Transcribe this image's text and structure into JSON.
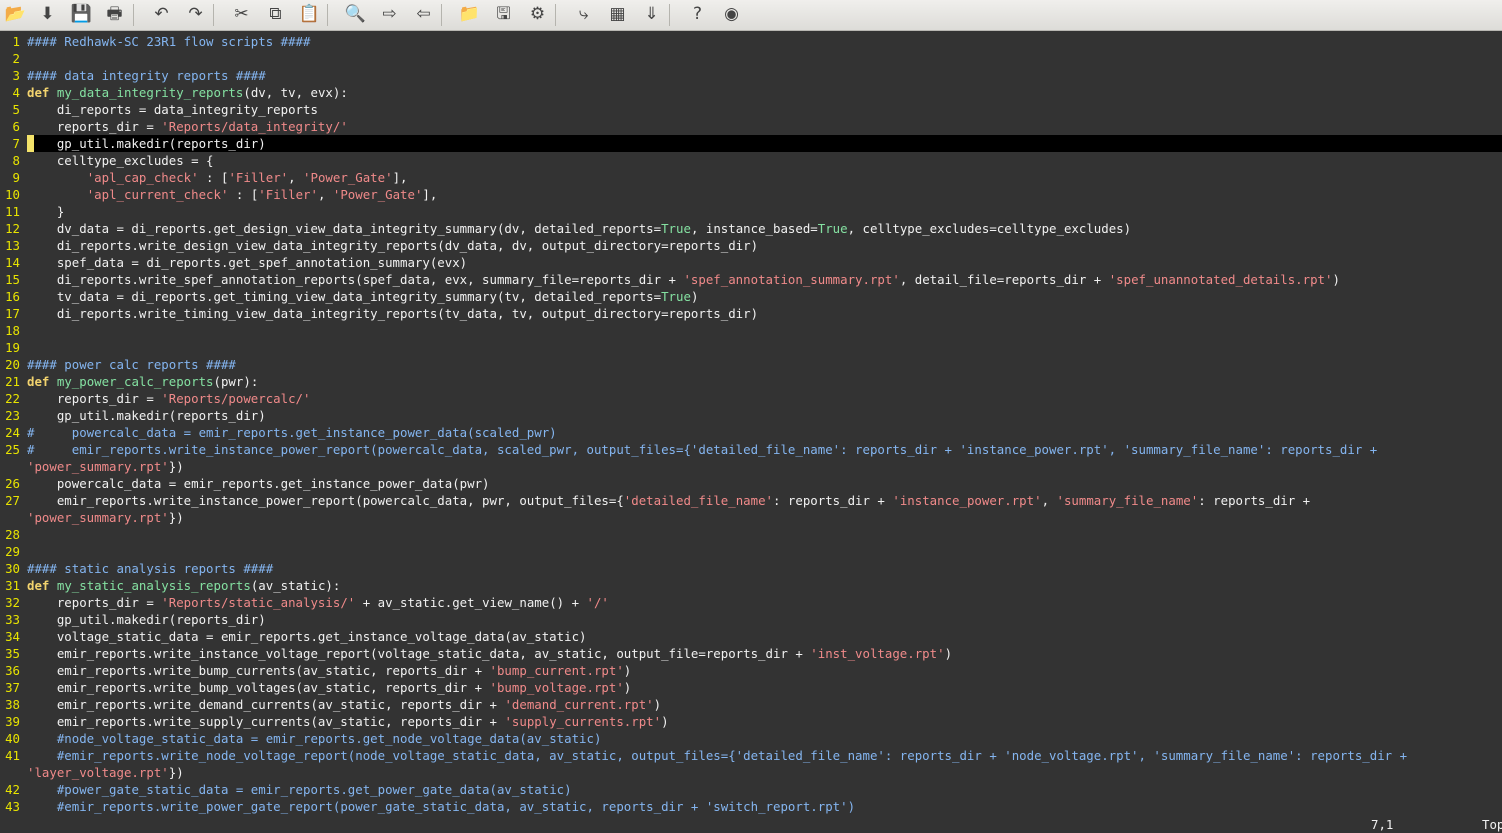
{
  "toolbar": {
    "buttons": [
      {
        "name": "open-icon",
        "glyph": "📂"
      },
      {
        "name": "load-icon",
        "glyph": "⬇"
      },
      {
        "name": "save-icon",
        "glyph": "💾"
      },
      {
        "name": "print-icon",
        "glyph": "🖶"
      },
      {
        "name": "undo-icon",
        "glyph": "↶"
      },
      {
        "name": "redo-icon",
        "glyph": "↷"
      },
      {
        "name": "cut-icon",
        "glyph": "✂"
      },
      {
        "name": "copy-icon",
        "glyph": "⧉"
      },
      {
        "name": "paste-icon",
        "glyph": "📋"
      },
      {
        "name": "find-replace-icon",
        "glyph": "🔍"
      },
      {
        "name": "find-next-icon",
        "glyph": "⇨"
      },
      {
        "name": "find-prev-icon",
        "glyph": "⇦"
      },
      {
        "name": "session-load-icon",
        "glyph": "📁"
      },
      {
        "name": "session-save-icon",
        "glyph": "🖫"
      },
      {
        "name": "run-script-icon",
        "glyph": "⚙"
      },
      {
        "name": "tag-jump-icon",
        "glyph": "⤷"
      },
      {
        "name": "build-icon",
        "glyph": "▦"
      },
      {
        "name": "make-icon",
        "glyph": "⇓"
      },
      {
        "name": "help-icon",
        "glyph": "?"
      },
      {
        "name": "find-help-icon",
        "glyph": "◉"
      }
    ]
  },
  "editor": {
    "cursor_line": 7,
    "lines": [
      {
        "n": "1",
        "t": "#### Redhawk-SC 23R1 flow scripts ####"
      },
      {
        "n": "2",
        "t": ""
      },
      {
        "n": "3",
        "t": "#### data integrity reports ####"
      },
      {
        "n": "4",
        "t": "def my_data_integrity_reports(dv, tv, evx):"
      },
      {
        "n": "5",
        "t": "    di_reports = data_integrity_reports"
      },
      {
        "n": "6",
        "t": "    reports_dir = 'Reports/data_integrity/'"
      },
      {
        "n": "7",
        "t": "    gp_util.makedir(reports_dir)"
      },
      {
        "n": "8",
        "t": "    celltype_excludes = {"
      },
      {
        "n": "9",
        "t": "        'apl_cap_check' : ['Filler', 'Power_Gate'],"
      },
      {
        "n": "10",
        "t": "        'apl_current_check' : ['Filler', 'Power_Gate'],"
      },
      {
        "n": "11",
        "t": "    }"
      },
      {
        "n": "12",
        "t": "    dv_data = di_reports.get_design_view_data_integrity_summary(dv, detailed_reports=True, instance_based=True, celltype_excludes=celltype_excludes)"
      },
      {
        "n": "13",
        "t": "    di_reports.write_design_view_data_integrity_reports(dv_data, dv, output_directory=reports_dir)"
      },
      {
        "n": "14",
        "t": "    spef_data = di_reports.get_spef_annotation_summary(evx)"
      },
      {
        "n": "15",
        "t": "    di_reports.write_spef_annotation_reports(spef_data, evx, summary_file=reports_dir + 'spef_annotation_summary.rpt', detail_file=reports_dir + 'spef_unannotated_details.rpt')"
      },
      {
        "n": "16",
        "t": "    tv_data = di_reports.get_timing_view_data_integrity_summary(tv, detailed_reports=True)"
      },
      {
        "n": "17",
        "t": "    di_reports.write_timing_view_data_integrity_reports(tv_data, tv, output_directory=reports_dir)"
      },
      {
        "n": "18",
        "t": ""
      },
      {
        "n": "19",
        "t": ""
      },
      {
        "n": "20",
        "t": "#### power calc reports ####"
      },
      {
        "n": "21",
        "t": "def my_power_calc_reports(pwr):"
      },
      {
        "n": "22",
        "t": "    reports_dir = 'Reports/powercalc/'"
      },
      {
        "n": "23",
        "t": "    gp_util.makedir(reports_dir)"
      },
      {
        "n": "24",
        "t": "#     powercalc_data = emir_reports.get_instance_power_data(scaled_pwr)"
      },
      {
        "n": "25",
        "t": "#     emir_reports.write_instance_power_report(powercalc_data, scaled_pwr, output_files={'detailed_file_name': reports_dir + 'instance_power.rpt', 'summary_file_name': reports_dir +"
      },
      {
        "n": "",
        "t": "'power_summary.rpt'})"
      },
      {
        "n": "26",
        "t": "    powercalc_data = emir_reports.get_instance_power_data(pwr)"
      },
      {
        "n": "27",
        "t": "    emir_reports.write_instance_power_report(powercalc_data, pwr, output_files={'detailed_file_name': reports_dir + 'instance_power.rpt', 'summary_file_name': reports_dir +"
      },
      {
        "n": "",
        "t": "'power_summary.rpt'})"
      },
      {
        "n": "28",
        "t": ""
      },
      {
        "n": "29",
        "t": ""
      },
      {
        "n": "30",
        "t": "#### static analysis reports ####"
      },
      {
        "n": "31",
        "t": "def my_static_analysis_reports(av_static):"
      },
      {
        "n": "32",
        "t": "    reports_dir = 'Reports/static_analysis/' + av_static.get_view_name() + '/'"
      },
      {
        "n": "33",
        "t": "    gp_util.makedir(reports_dir)"
      },
      {
        "n": "34",
        "t": "    voltage_static_data = emir_reports.get_instance_voltage_data(av_static)"
      },
      {
        "n": "35",
        "t": "    emir_reports.write_instance_voltage_report(voltage_static_data, av_static, output_file=reports_dir + 'inst_voltage.rpt')"
      },
      {
        "n": "36",
        "t": "    emir_reports.write_bump_currents(av_static, reports_dir + 'bump_current.rpt')"
      },
      {
        "n": "37",
        "t": "    emir_reports.write_bump_voltages(av_static, reports_dir + 'bump_voltage.rpt')"
      },
      {
        "n": "38",
        "t": "    emir_reports.write_demand_currents(av_static, reports_dir + 'demand_current.rpt')"
      },
      {
        "n": "39",
        "t": "    emir_reports.write_supply_currents(av_static, reports_dir + 'supply_currents.rpt')"
      },
      {
        "n": "40",
        "t": "    #node_voltage_static_data = emir_reports.get_node_voltage_data(av_static)"
      },
      {
        "n": "41",
        "t": "    #emir_reports.write_node_voltage_report(node_voltage_static_data, av_static, output_files={'detailed_file_name': reports_dir + 'node_voltage.rpt', 'summary_file_name': reports_dir +"
      },
      {
        "n": "",
        "t": "'layer_voltage.rpt'})"
      },
      {
        "n": "42",
        "t": "    #power_gate_static_data = emir_reports.get_power_gate_data(av_static)"
      },
      {
        "n": "43",
        "t": "    #emir_reports.write_power_gate_report(power_gate_static_data, av_static, reports_dir + 'switch_report.rpt')"
      }
    ],
    "comment_continuations": [
      42
    ]
  },
  "status": {
    "position": "7,1",
    "scroll": "Top"
  }
}
